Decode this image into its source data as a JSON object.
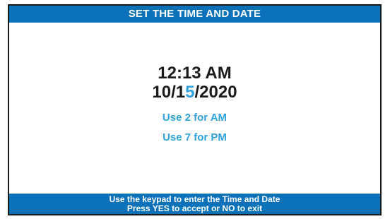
{
  "header": {
    "title": "SET THE TIME AND DATE"
  },
  "main": {
    "time": "12:13 AM",
    "date": {
      "before_cursor": "10/1",
      "cursor_digit": "5",
      "after_cursor": "/2020"
    },
    "hint_am": "Use 2 for AM",
    "hint_pm": "Use 7 for PM"
  },
  "footer": {
    "line1": "Use the keypad to enter the Time and Date",
    "line2": "Press YES to accept or NO to exit"
  },
  "colors": {
    "header_bg": "#0b72b9",
    "accent_text": "#2ea3dc",
    "primary_text": "#1a1a1a"
  }
}
